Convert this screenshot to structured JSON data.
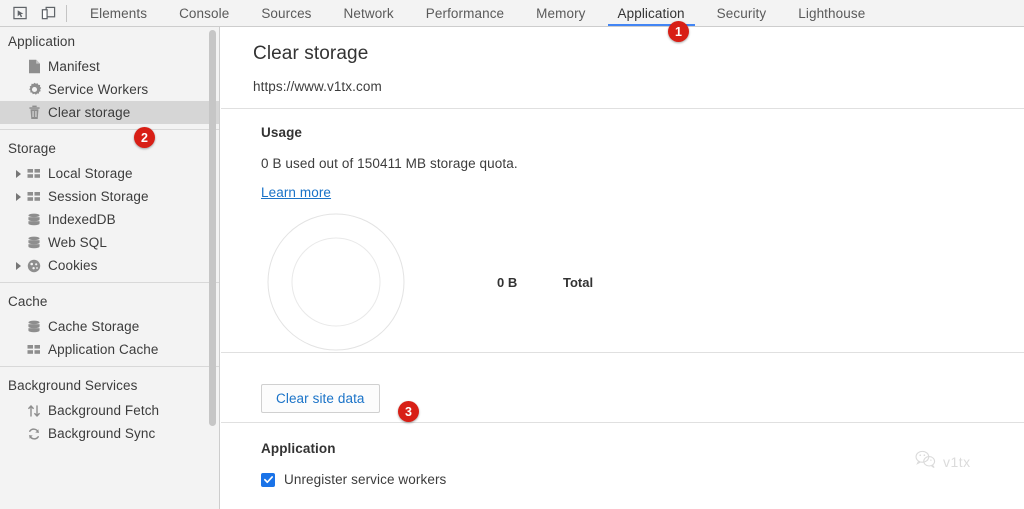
{
  "toolbar": {
    "inspect_icon": "inspect-cursor-icon",
    "device_icon": "device-toolbar-icon",
    "tabs": [
      {
        "label": "Elements",
        "active": false
      },
      {
        "label": "Console",
        "active": false
      },
      {
        "label": "Sources",
        "active": false
      },
      {
        "label": "Network",
        "active": false
      },
      {
        "label": "Performance",
        "active": false
      },
      {
        "label": "Memory",
        "active": false
      },
      {
        "label": "Application",
        "active": true
      },
      {
        "label": "Security",
        "active": false
      },
      {
        "label": "Lighthouse",
        "active": false
      }
    ],
    "active_tab": "Application",
    "accent_color": "#4285f4"
  },
  "sidebar": {
    "groups": [
      {
        "title": "Application",
        "items": [
          {
            "label": "Manifest",
            "icon": "document-icon",
            "expandable": false,
            "selected": false
          },
          {
            "label": "Service Workers",
            "icon": "gear-icon",
            "expandable": false,
            "selected": false
          },
          {
            "label": "Clear storage",
            "icon": "trash-icon",
            "expandable": false,
            "selected": true
          }
        ]
      },
      {
        "title": "Storage",
        "items": [
          {
            "label": "Local Storage",
            "icon": "table-icon",
            "expandable": true,
            "selected": false
          },
          {
            "label": "Session Storage",
            "icon": "table-icon",
            "expandable": true,
            "selected": false
          },
          {
            "label": "IndexedDB",
            "icon": "database-icon",
            "expandable": false,
            "selected": false
          },
          {
            "label": "Web SQL",
            "icon": "database-icon",
            "expandable": false,
            "selected": false
          },
          {
            "label": "Cookies",
            "icon": "cookie-icon",
            "expandable": true,
            "selected": false
          }
        ]
      },
      {
        "title": "Cache",
        "items": [
          {
            "label": "Cache Storage",
            "icon": "database-icon",
            "expandable": false,
            "selected": false
          },
          {
            "label": "Application Cache",
            "icon": "table-icon",
            "expandable": false,
            "selected": false
          }
        ]
      },
      {
        "title": "Background Services",
        "items": [
          {
            "label": "Background Fetch",
            "icon": "updown-arrows-icon",
            "expandable": false,
            "selected": false
          },
          {
            "label": "Background Sync",
            "icon": "refresh-icon",
            "expandable": false,
            "selected": false
          }
        ]
      }
    ]
  },
  "main": {
    "title": "Clear storage",
    "origin": "https://www.v1tx.com",
    "usage": {
      "heading": "Usage",
      "text": "0 B used out of 150411 MB storage quota.",
      "learn_more": "Learn more"
    },
    "chart_data": {
      "type": "pie",
      "title": "Storage usage breakdown",
      "categories": [
        "Total"
      ],
      "values": [
        0
      ],
      "value_labels": [
        "0 B"
      ],
      "legend": [
        {
          "value": "0 B",
          "label": "Total"
        }
      ],
      "legend_position": "right",
      "empty": true,
      "ring_color": "#e6e6e6"
    },
    "clear_button": "Clear site data",
    "application": {
      "heading": "Application",
      "checkboxes": [
        {
          "label": "Unregister service workers",
          "checked": true
        }
      ]
    },
    "link_color": "#1a73c8",
    "checkbox_color": "#1a73e8"
  },
  "annotations": [
    {
      "number": "1",
      "target": "Application tab"
    },
    {
      "number": "2",
      "target": "Clear storage sidebar item"
    },
    {
      "number": "3",
      "target": "Clear site data button"
    }
  ],
  "watermark": {
    "icon": "wechat-icon",
    "text": "v1tx"
  }
}
